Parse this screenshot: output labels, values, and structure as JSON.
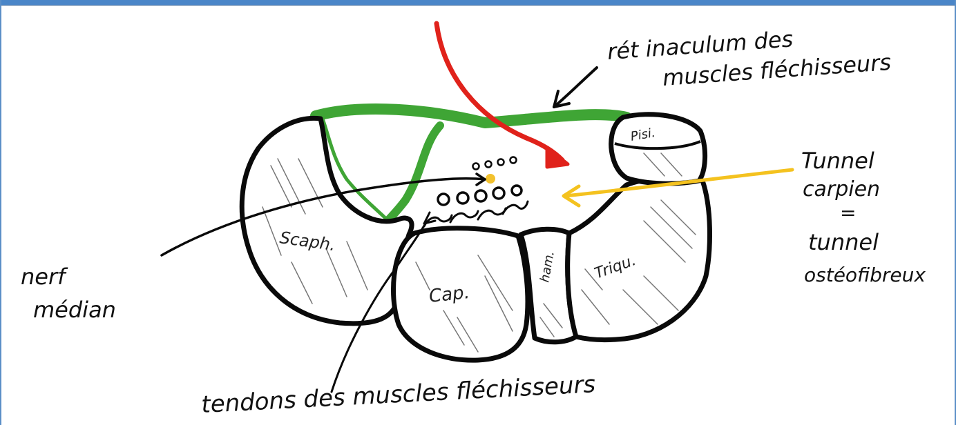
{
  "labels": {
    "retinaculum_line1": "rét inaculum des",
    "retinaculum_line2": "muscles fléchisseurs",
    "tunnel_line1": "Tunnel",
    "tunnel_line2": "carpien",
    "tunnel_equals": "=",
    "tunnel_line3": "tunnel",
    "tunnel_line4": "ostéofibreux",
    "nerf_line1": "nerf",
    "nerf_line2": "médian",
    "tendons": "tendons des muscles fléchisseurs"
  },
  "bones": {
    "scaphoid": "Scaph.",
    "capitate": "Cap.",
    "hamate": "ham.",
    "triquetrum": "Triqu.",
    "pisiform": "Pisi."
  },
  "colors": {
    "retinaculum": "#3fa535",
    "red_arrow": "#e0221b",
    "yellow_arrow": "#f4c21f",
    "nerve_dot": "#f2c12e",
    "outline": "#0a0a0a",
    "frame": "#4a86c8"
  }
}
